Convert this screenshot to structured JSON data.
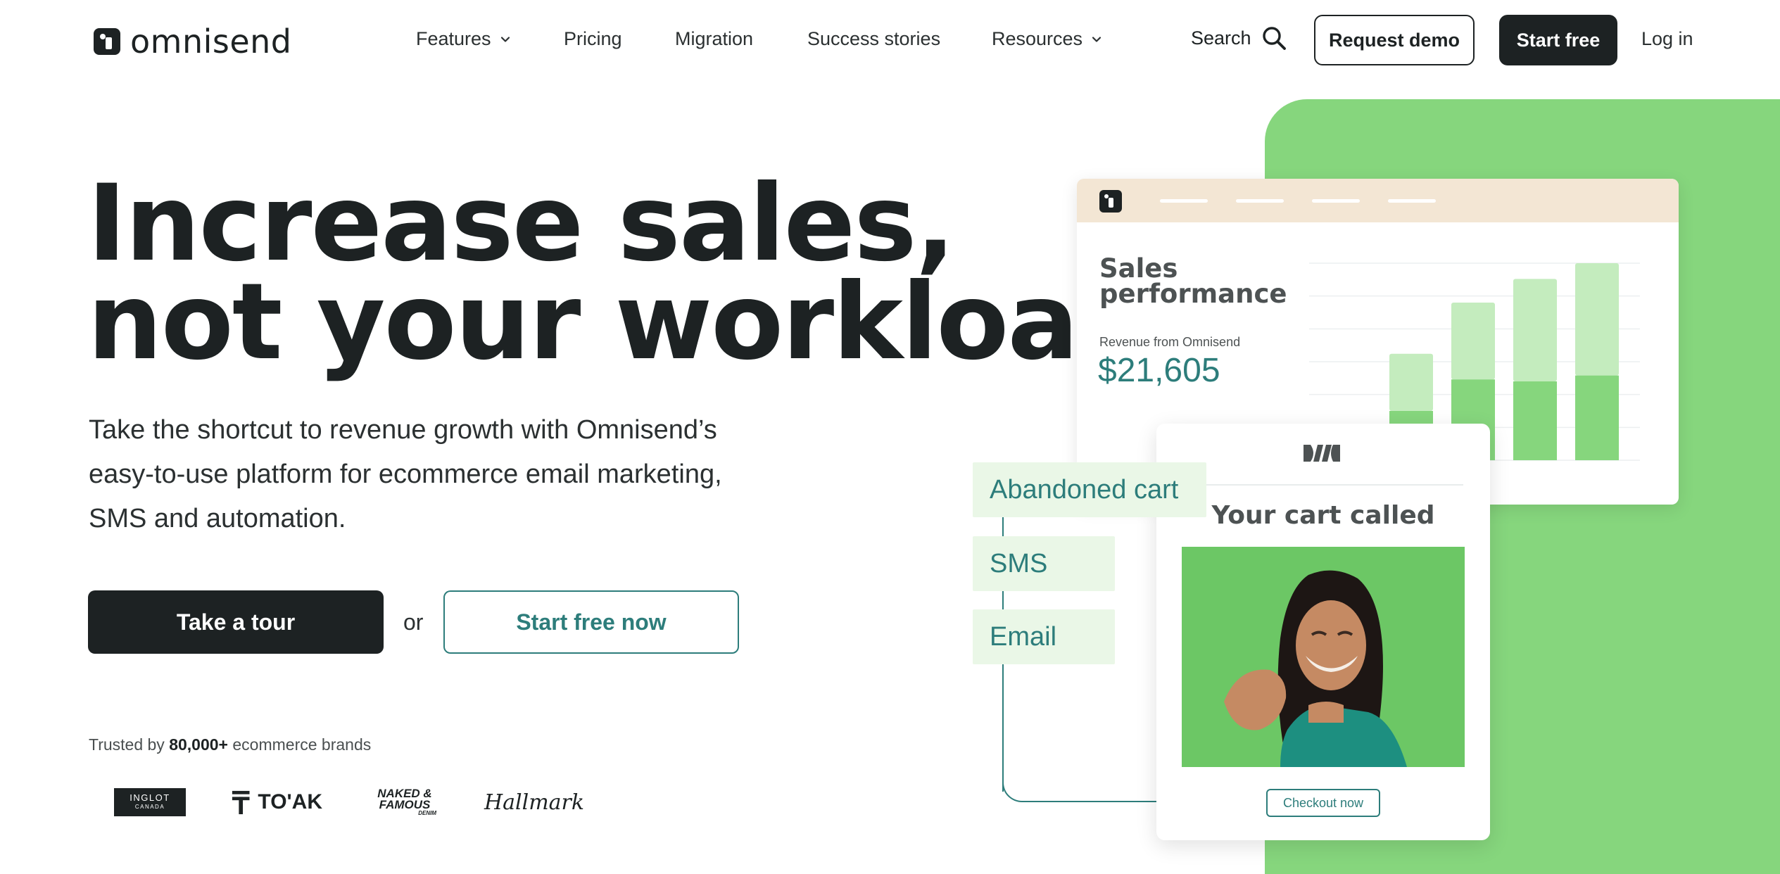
{
  "nav": {
    "logo_text": "omnisend",
    "items": [
      {
        "label": "Features",
        "dropdown": true
      },
      {
        "label": "Pricing",
        "dropdown": false
      },
      {
        "label": "Migration",
        "dropdown": false
      },
      {
        "label": "Success stories",
        "dropdown": false
      },
      {
        "label": "Resources",
        "dropdown": true
      }
    ],
    "search_label": "Search",
    "request_demo": "Request demo",
    "start_free": "Start free",
    "login": "Log in"
  },
  "hero": {
    "headline_line1": "Increase sales,",
    "headline_line2": "not your workload",
    "subtext": "Take the shortcut to revenue growth with Omnisend’s easy-to-use platform for ecommerce email marketing, SMS and automation.",
    "take_tour": "Take a tour",
    "or": "or",
    "start_free_now": "Start free now",
    "trusted_prefix": "Trusted by ",
    "trusted_count": "80,000+",
    "trusted_suffix": " ecommerce brands"
  },
  "brands": {
    "inglot_name": "INGLOT",
    "inglot_region": "CANADA",
    "toak": "TO'AK",
    "naked_line1": "NAKED &",
    "naked_line2": "FAMOUS",
    "naked_line3": "DENIM",
    "hallmark": "Hallmark"
  },
  "dashboard": {
    "title": "Sales performance",
    "revenue_label": "Revenue from Omnisend",
    "revenue_value": "$21,605",
    "chart_data": {
      "type": "bar",
      "series": [
        {
          "values": [
            0.06,
            0.29,
            0.39,
            0.52,
            0.57
          ]
        },
        {
          "values": [
            0.03,
            0.25,
            0.41,
            0.4,
            0.43
          ]
        }
      ]
    }
  },
  "email": {
    "title": "Your cart called",
    "checkout": "Checkout now"
  },
  "flow_tags": {
    "cart": "Abandoned cart",
    "sms": "SMS",
    "email": "Email"
  },
  "colors": {
    "dark": "#1d2223",
    "teal": "#2d7d7b",
    "green": "#86d67d",
    "light_green": "#c4ecbe",
    "tag_bg": "#eaf7e7",
    "dash_header": "#f3e6d4"
  }
}
